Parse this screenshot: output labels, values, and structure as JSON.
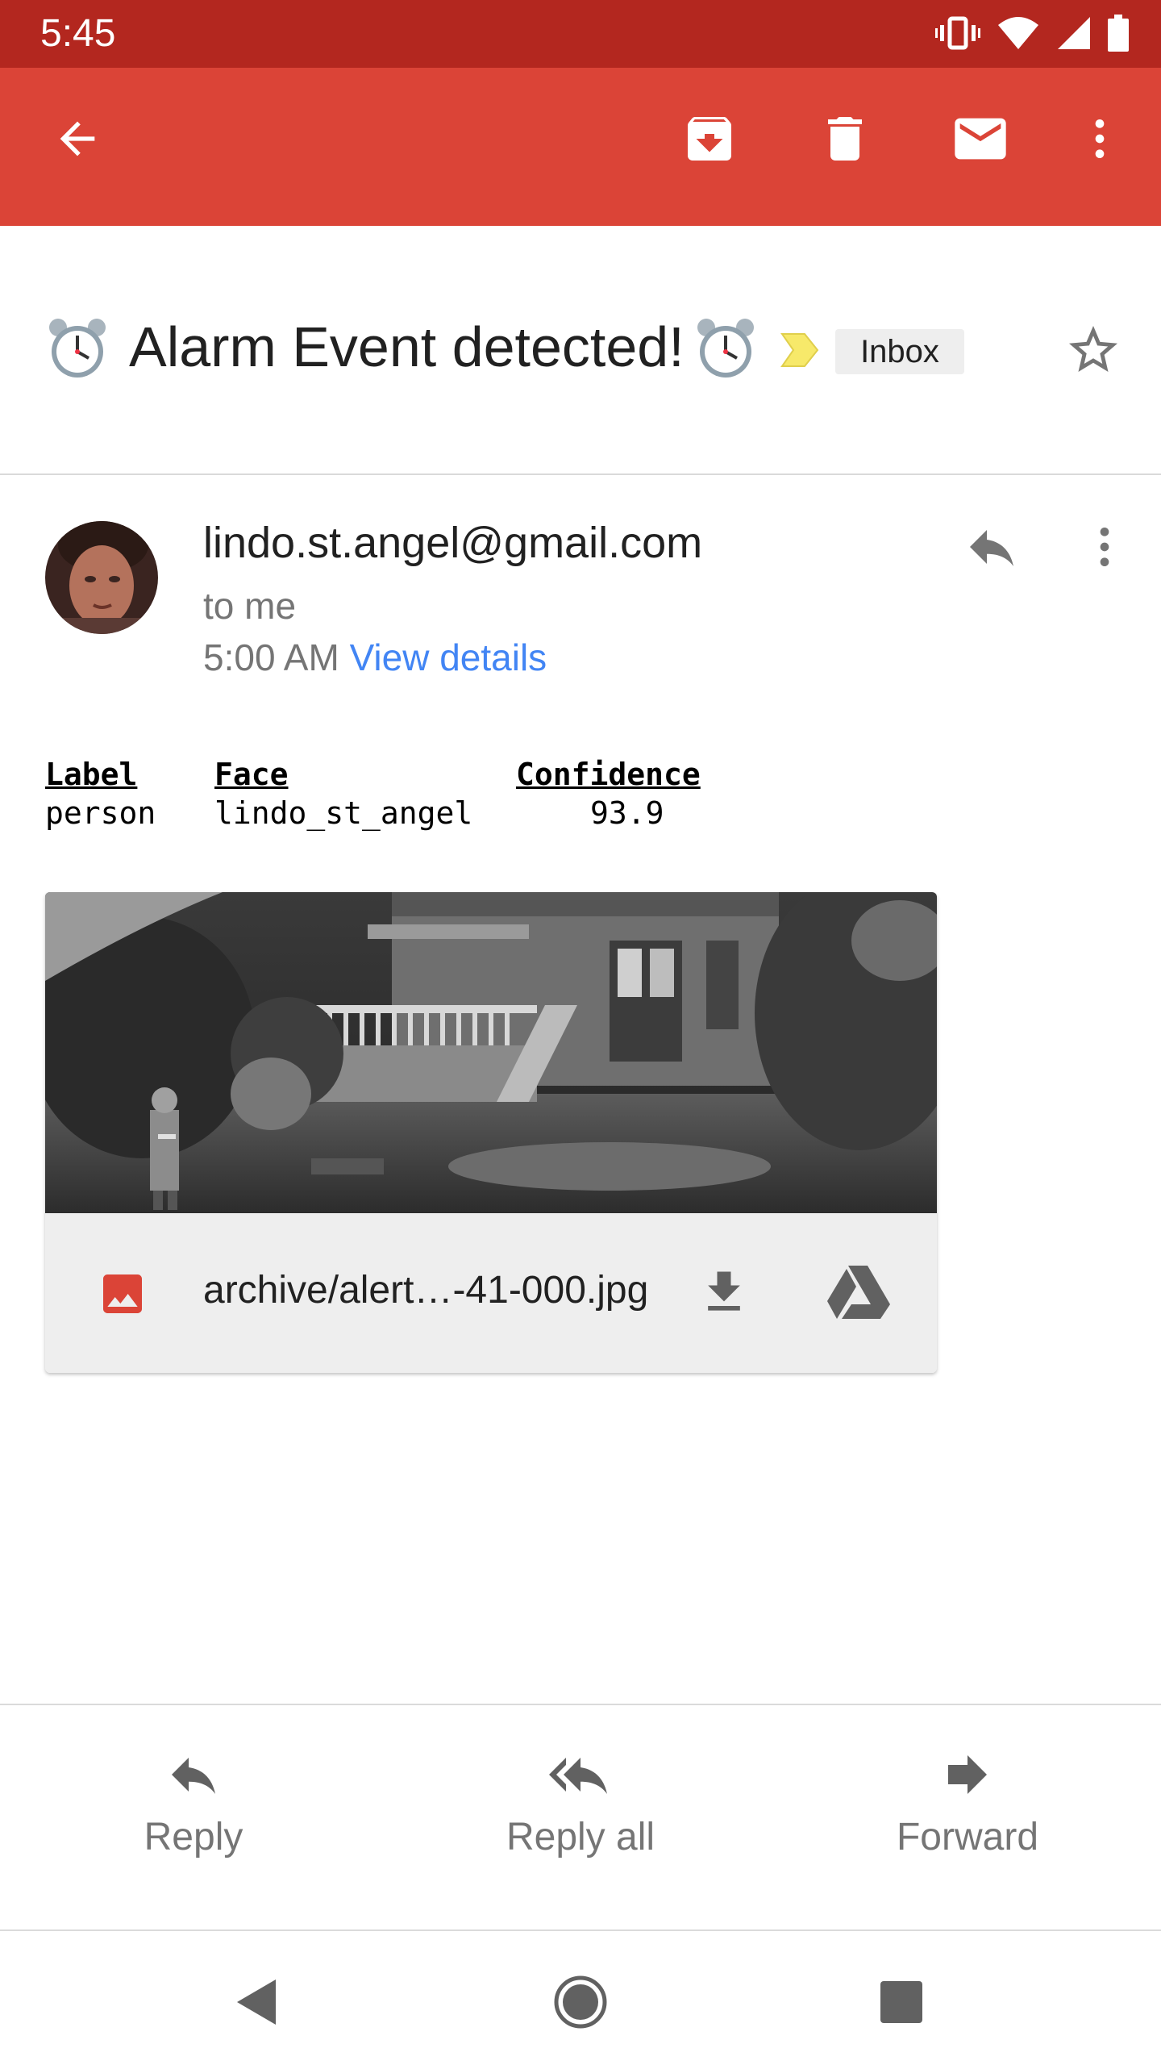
{
  "status_bar": {
    "time": "5:45",
    "icons": [
      "vibrate-icon",
      "wifi-icon",
      "cell-signal-icon",
      "battery-icon"
    ]
  },
  "toolbar": {
    "back_icon": "arrow-left-icon",
    "actions": [
      "archive-icon",
      "delete-icon",
      "mark-unread-icon",
      "more-vert-icon"
    ],
    "background": "#db4437"
  },
  "subject": {
    "text": "Alarm Event detected!",
    "emoji": "alarm-clock-icon",
    "label": "Inbox",
    "important_marker": "importance-marker-icon",
    "star": "star-outline-icon"
  },
  "message": {
    "sender": "lindo.st.angel@gmail.com",
    "recipient": "to me",
    "time": "5:00 AM",
    "details_link": "View details",
    "accent_link_color": "#4285f4"
  },
  "detection_table": {
    "headers": [
      "Label",
      "Face",
      "Confidence"
    ],
    "rows": [
      [
        "person",
        "lindo_st_angel",
        "93.9"
      ]
    ]
  },
  "attachment": {
    "filename": "archive/alert…-41-000.jpg",
    "type_icon": "image-file-icon",
    "actions": [
      "download-icon",
      "google-drive-icon"
    ]
  },
  "actions": {
    "reply": "Reply",
    "reply_all": "Reply all",
    "forward": "Forward"
  },
  "nav_bar": {
    "buttons": [
      "nav-back-icon",
      "nav-home-icon",
      "nav-recents-icon"
    ]
  }
}
